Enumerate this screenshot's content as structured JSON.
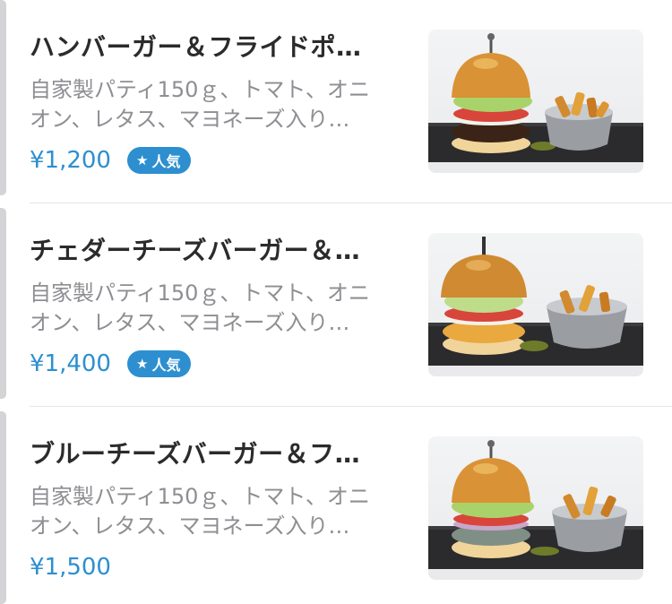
{
  "colors": {
    "price": "#2d8fcf",
    "badge_background": "#2d8fcf",
    "title": "#2b2b2b",
    "description": "#8e8e93",
    "divider": "#e6e6e8"
  },
  "menu": {
    "items": [
      {
        "title": "ハンバーガー＆フライドポ…",
        "description_line1": "自家製パティ150ｇ、トマト、オニ",
        "description_line2": "オン、レタス、マヨネーズ入り…",
        "price": "¥1,200",
        "badge": "人気",
        "badge_icon": "star-icon",
        "photo": "hamburger-with-fries-photo"
      },
      {
        "title": "チェダーチーズバーガー＆…",
        "description_line1": "自家製パティ150ｇ、トマト、オニ",
        "description_line2": "オン、レタス、マヨネーズ入り…",
        "price": "¥1,400",
        "badge": "人気",
        "badge_icon": "star-icon",
        "photo": "cheddar-cheeseburger-with-fries-photo"
      },
      {
        "title": "ブルーチーズバーガー＆フ…",
        "description_line1": "自家製パティ150ｇ、トマト、オニ",
        "description_line2": "オン、レタス、マヨネーズ入り…",
        "price": "¥1,500",
        "photo": "blue-cheeseburger-with-fries-photo"
      }
    ]
  }
}
